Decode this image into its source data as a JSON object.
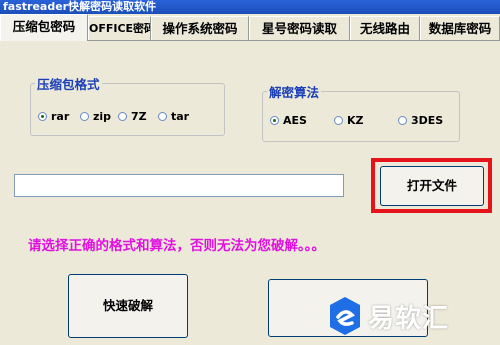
{
  "window": {
    "title": "fastreader快解密码读取软件"
  },
  "tabs": [
    {
      "label": "压缩包密码",
      "active": true
    },
    {
      "label": "OFFICE密码",
      "active": false
    },
    {
      "label": "操作系统密码",
      "active": false
    },
    {
      "label": "星号密码读取",
      "active": false
    },
    {
      "label": "无线路由",
      "active": false
    },
    {
      "label": "数据库密码",
      "active": false
    }
  ],
  "format_group": {
    "title": "压缩包格式",
    "options": [
      "rar",
      "zip",
      "7Z",
      "tar"
    ],
    "selected": "rar"
  },
  "algo_group": {
    "title": "解密算法",
    "options": [
      "AES",
      "KZ",
      "3DES"
    ],
    "selected": "AES"
  },
  "file": {
    "path_value": "",
    "open_button": "打开文件"
  },
  "hint": "请选择正确的格式和算法，否则无法为您破解。。。",
  "actions": {
    "quick_crack": "快速破解",
    "second_button": ""
  },
  "watermark": {
    "text": "易软汇"
  },
  "colors": {
    "titlebar": "#1b4fb9",
    "hint": "#e012e0",
    "highlight_frame": "#e5141b",
    "watermark_logo": "#1e6ee6"
  }
}
